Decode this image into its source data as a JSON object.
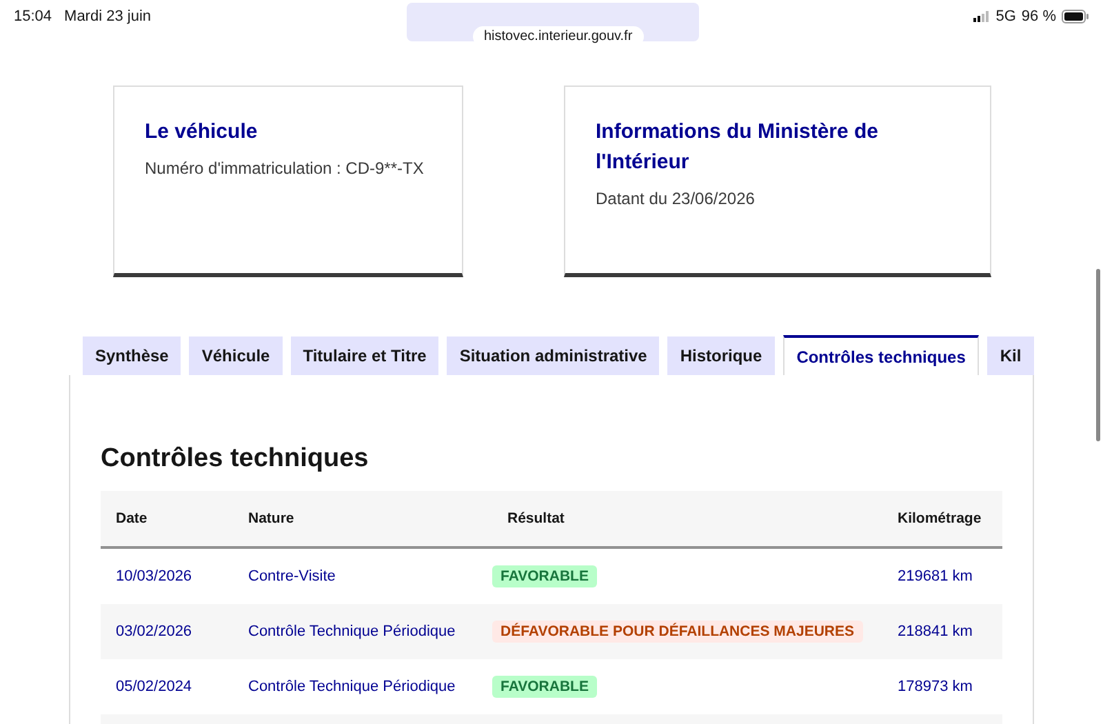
{
  "status_bar": {
    "time": "15:04",
    "date": "Mardi 23 juin",
    "network": "5G",
    "battery": "96 %"
  },
  "address_bar": {
    "url": "histovec.interieur.gouv.fr"
  },
  "cards": [
    {
      "title": "Le véhicule",
      "text": "Numéro d'immatriculation : CD-9**-TX"
    },
    {
      "title": "Informations du Ministère de l'Intérieur",
      "text": "Datant du 23/06/2026"
    }
  ],
  "tabs": [
    {
      "label": "Synthèse",
      "selected": false
    },
    {
      "label": "Véhicule",
      "selected": false
    },
    {
      "label": "Titulaire et Titre",
      "selected": false
    },
    {
      "label": "Situation administrative",
      "selected": false
    },
    {
      "label": "Historique",
      "selected": false
    },
    {
      "label": "Contrôles techniques",
      "selected": true
    },
    {
      "label": "Kil",
      "selected": false
    }
  ],
  "section": {
    "title": "Contrôles techniques"
  },
  "table": {
    "columns": [
      "Date",
      "Nature",
      "Résultat",
      "Kilométrage"
    ],
    "rows": [
      {
        "date": "10/03/2026",
        "nature": "Contre-Visite",
        "result": {
          "label": "FAVORABLE",
          "kind": "success"
        },
        "mileage": "219681 km"
      },
      {
        "date": "03/02/2026",
        "nature": "Contrôle Technique Périodique",
        "result": {
          "label": "DÉFAVORABLE POUR DÉFAILLANCES MAJEURES",
          "kind": "error"
        },
        "mileage": "218841 km"
      },
      {
        "date": "05/02/2024",
        "nature": "Contrôle Technique Périodique",
        "result": {
          "label": "FAVORABLE",
          "kind": "success"
        },
        "mileage": "178973 km"
      }
    ]
  }
}
